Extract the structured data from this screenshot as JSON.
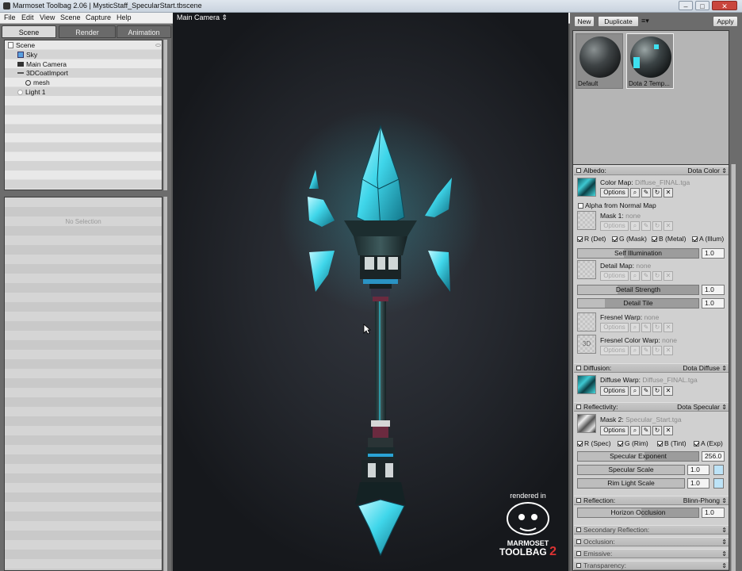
{
  "window": {
    "title": "Marmoset Toolbag 2.06  |  MysticStaff_SpecularStart.tbscene",
    "minimize": "–",
    "maximize": "□",
    "close": "✕"
  },
  "menu": [
    "File",
    "Edit",
    "View",
    "Scene",
    "Capture",
    "Help"
  ],
  "left_tabs": [
    "Scene",
    "Render",
    "Animation"
  ],
  "outliner": [
    {
      "label": "Scene",
      "icon": "scene-icon"
    },
    {
      "label": "Sky",
      "icon": "sky-icon"
    },
    {
      "label": "Main Camera",
      "icon": "camera-icon"
    },
    {
      "label": "3DCoatImport",
      "icon": "object-icon"
    },
    {
      "label": "mesh",
      "icon": "mesh-icon"
    },
    {
      "label": "Light 1",
      "icon": "light-icon"
    }
  ],
  "properties_empty": "No Selection",
  "viewport": {
    "camera_menu": "Main Camera ⇕",
    "watermark_top": "rendered in",
    "watermark_brand": "MARMOSET",
    "watermark_product": "TOOLBAG",
    "watermark_version": "2"
  },
  "toolbar_right": {
    "new": "New",
    "duplicate": "Duplicate",
    "apply": "Apply"
  },
  "materials": [
    "Default",
    "Dota 2 Temp..."
  ],
  "albedo": {
    "title": "Albedo:",
    "mode": "Dota Color",
    "color_map_label": "Color Map:",
    "color_map_value": "Diffuse_FINAL.tga",
    "options": "Options",
    "alpha_label": "Alpha from Normal Map",
    "mask1_label": "Mask 1:",
    "mask1_value": "none",
    "channels": [
      "R (Det)",
      "G (Mask)",
      "B (Metal)",
      "A (Illum)"
    ],
    "self_illum_label": "Self Illumination",
    "self_illum_value": "1.0",
    "detail_map_label": "Detail Map:",
    "detail_map_value": "none",
    "detail_strength_label": "Detail Strength",
    "detail_strength_value": "1.0",
    "detail_tile_label": "Detail Tile",
    "detail_tile_value": "1.0",
    "fresnel_warp_label": "Fresnel Warp:",
    "fresnel_warp_value": "none",
    "fresnel_color_label": "Fresnel Color Warp:",
    "fresnel_color_value": "none",
    "thumb_3d": "3D"
  },
  "diffusion": {
    "title": "Diffusion:",
    "mode": "Dota Diffuse",
    "warp_label": "Diffuse Warp:",
    "warp_value": "Diffuse_FINAL.tga",
    "options": "Options"
  },
  "reflectivity": {
    "title": "Reflectivity:",
    "mode": "Dota Specular",
    "mask2_label": "Mask 2:",
    "mask2_value": "Specular_Start.tga",
    "options": "Options",
    "channels": [
      "R (Spec)",
      "G (Rim)",
      "B (Tint)",
      "A (Exp)"
    ],
    "spec_exp_label": "Specular Exponent",
    "spec_exp_value": "256.0",
    "spec_exp_level": 0.55,
    "spec_scale_label": "Specular Scale",
    "spec_scale_value": "1.0",
    "rim_scale_label": "Rim Light Scale",
    "rim_scale_value": "1.0",
    "swatch_color": "#bde3f7"
  },
  "reflection": {
    "title": "Reflection:",
    "mode": "Blinn-Phong",
    "horizon_label": "Horizon Occlusion",
    "horizon_value": "1.0"
  },
  "collapsed": [
    "Secondary Reflection:",
    "Occlusion:",
    "Emissive:",
    "Transparency:"
  ],
  "icons": {
    "search": "magnifier-icon",
    "edit": "pencil-icon",
    "reload": "reload-icon",
    "clear": "close-icon"
  },
  "colors": {
    "accent_glow": "#3ee0f0",
    "viewport_bg": "#24272d"
  }
}
